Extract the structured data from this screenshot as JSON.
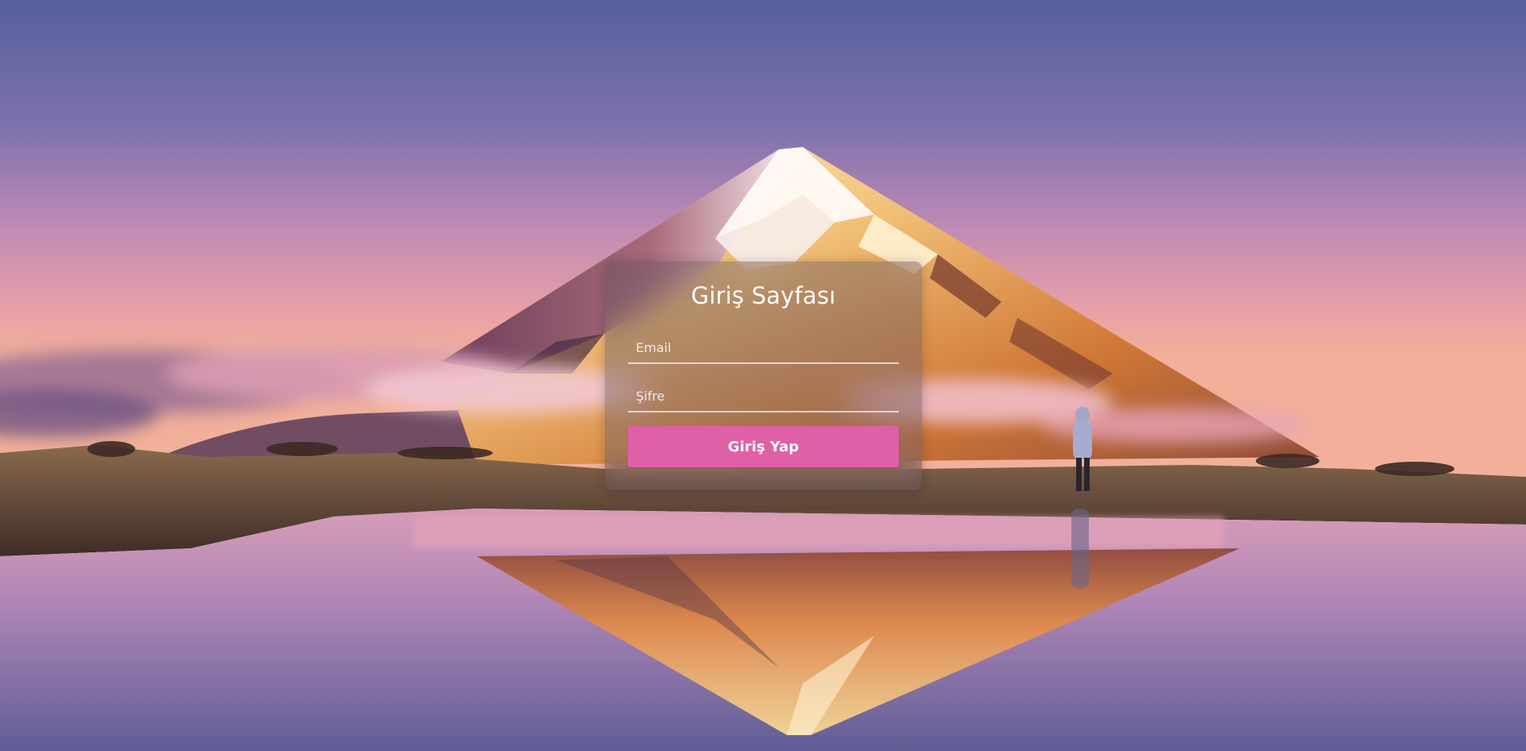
{
  "login": {
    "title": "Giriş Sayfası",
    "email_placeholder": "Email",
    "password_placeholder": "Şifre",
    "submit_label": "Giriş Yap"
  },
  "colors": {
    "accent": "#e060a8",
    "sky_top": "#58619a",
    "sky_horizon": "#e8a0a8"
  }
}
